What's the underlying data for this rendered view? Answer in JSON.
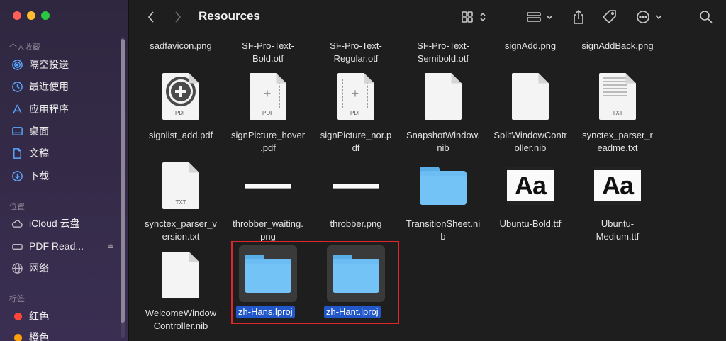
{
  "window": {
    "title": "Resources"
  },
  "sidebar": {
    "favorites_header": "个人收藏",
    "favorites": [
      {
        "label": "隔空投送",
        "icon": "airdrop-icon"
      },
      {
        "label": "最近使用",
        "icon": "clock-icon"
      },
      {
        "label": "应用程序",
        "icon": "applications-icon"
      },
      {
        "label": "桌面",
        "icon": "desktop-icon"
      },
      {
        "label": "文稿",
        "icon": "document-icon"
      },
      {
        "label": "下载",
        "icon": "download-icon"
      }
    ],
    "locations_header": "位置",
    "locations": [
      {
        "label": "iCloud 云盘",
        "icon": "cloud-icon"
      },
      {
        "label": "PDF Read...",
        "icon": "drive-icon",
        "eject": "⏏"
      },
      {
        "label": "网络",
        "icon": "network-icon"
      }
    ],
    "tags_header": "标签",
    "tags": [
      {
        "label": "红色",
        "color": "#ff453a"
      },
      {
        "label": "橙色",
        "color": "#ff9f0a"
      }
    ]
  },
  "files": {
    "row0": [
      "sadfavicon.png",
      "SF-Pro-Text-Bold.otf",
      "SF-Pro-Text-Regular.otf",
      "SF-Pro-Text-Semibold.otf",
      "signAdd.png",
      "signAddBack.png"
    ],
    "row0_lines": [
      [
        "sadfavicon.png"
      ],
      [
        "SF-Pro-Text-",
        "Bold.otf"
      ],
      [
        "SF-Pro-Text-",
        "Regular.otf"
      ],
      [
        "SF-Pro-Text-",
        "Semibold.otf"
      ],
      [
        "signAdd.png"
      ],
      [
        "signAddBack.png"
      ]
    ],
    "row1": [
      {
        "name": [
          "signlist_add.pdf"
        ],
        "icon": "pdf-plus",
        "type_label": "PDF"
      },
      {
        "name": [
          "signPicture_hover",
          ".pdf"
        ],
        "icon": "pdf-blank",
        "type_label": "PDF"
      },
      {
        "name": [
          "signPicture_nor.p",
          "df"
        ],
        "icon": "pdf-blank",
        "type_label": "PDF"
      },
      {
        "name": [
          "SnapshotWindow.",
          "nib"
        ],
        "icon": "doc"
      },
      {
        "name": [
          "SplitWindowContr",
          "oller.nib"
        ],
        "icon": "doc"
      },
      {
        "name": [
          "synctex_parser_r",
          "eadme.txt"
        ],
        "icon": "txt",
        "type_label": "TXT"
      }
    ],
    "row2": [
      {
        "name": [
          "synctex_parser_v",
          "ersion.txt"
        ],
        "icon": "txt",
        "type_label": "TXT"
      },
      {
        "name": [
          "throbber_waiting.",
          "png"
        ],
        "icon": "throbber"
      },
      {
        "name": [
          "throbber.png"
        ],
        "icon": "throbber"
      },
      {
        "name": [
          "TransitionSheet.ni",
          "b"
        ],
        "icon": "folder"
      },
      {
        "name": [
          "Ubuntu-Bold.ttf"
        ],
        "icon": "font",
        "glyph": "Aa"
      },
      {
        "name": [
          "Ubuntu-",
          "Medium.ttf"
        ],
        "icon": "font",
        "glyph": "Aa"
      }
    ],
    "row3": [
      {
        "name": [
          "WelcomeWindow",
          "Controller.nib"
        ],
        "icon": "doc"
      },
      {
        "name": [
          "zh-Hans.lproj"
        ],
        "icon": "folder",
        "selected": true
      },
      {
        "name": [
          "zh-Hant.lproj"
        ],
        "icon": "folder",
        "selected": true
      }
    ]
  }
}
